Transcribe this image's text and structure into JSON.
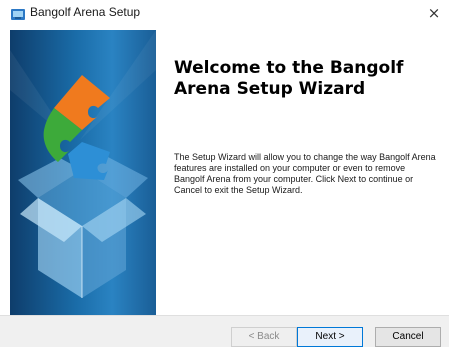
{
  "window": {
    "title": "Bangolf Arena Setup",
    "close_glyph": "×",
    "icon": "installer-icon"
  },
  "banner": {
    "image": "puzzle-box-graphic"
  },
  "welcome": {
    "title": "Welcome to the Bangolf Arena Setup Wizard",
    "body": "The Setup Wizard will allow you to change the way Bangolf Arena features are installed on your computer or even to remove Bangolf Arena from your computer.  Click Next to continue or Cancel to exit the Setup Wizard."
  },
  "buttons": {
    "back": "< Back",
    "next": "Next >",
    "cancel": "Cancel"
  },
  "colors": {
    "accent": "#0078d7",
    "banner_dark": "#0e3d6b",
    "banner_light": "#2a83c2",
    "puzzle_orange": "#f07a1e",
    "puzzle_green": "#3daa3a",
    "puzzle_blue": "#2d8fd6"
  }
}
